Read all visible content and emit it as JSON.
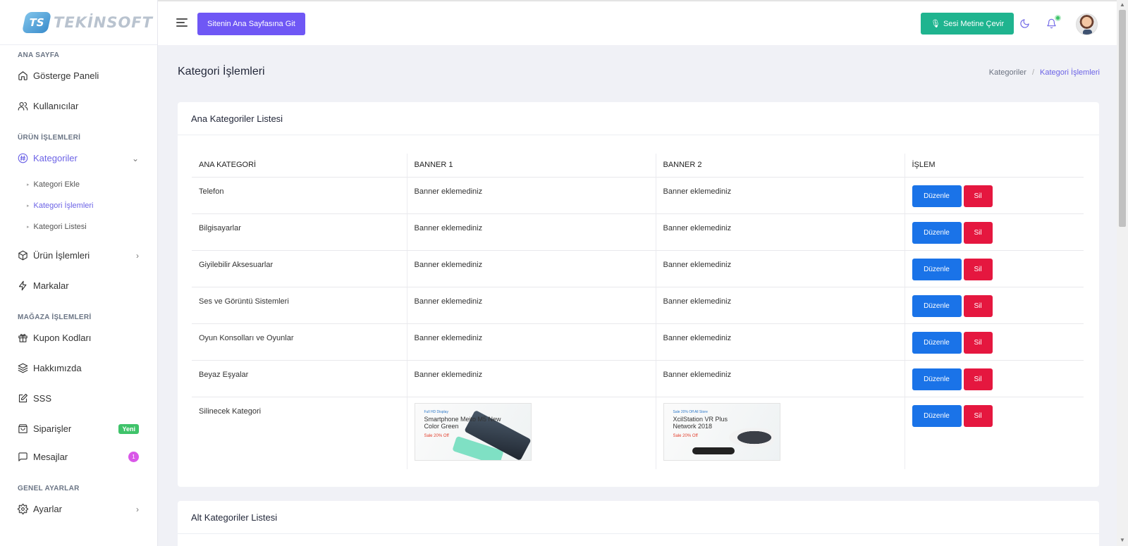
{
  "brand": {
    "logo_mark": "TS",
    "name": "TEKİNSOFT"
  },
  "sidebar": {
    "sections": {
      "home": "ANA SAYFA",
      "products": "ÜRÜN İŞLEMLERİ",
      "store": "MAĞAZA İŞLEMLERİ",
      "general": "GENEL AYARLAR"
    },
    "items": {
      "dashboard": "Gösterge Paneli",
      "users": "Kullanıcılar",
      "categories": "Kategoriler",
      "sub_add": "Kategori Ekle",
      "sub_ops": "Kategori İşlemleri",
      "sub_list": "Kategori Listesi",
      "product_ops": "Ürün İşlemleri",
      "brands": "Markalar",
      "coupons": "Kupon Kodları",
      "about": "Hakkımızda",
      "faq": "SSS",
      "orders": "Siparişler",
      "orders_badge": "Yeni",
      "messages": "Mesajlar",
      "messages_count": "1",
      "settings": "Ayarlar"
    }
  },
  "topbar": {
    "go_site": "Sitenin Ana Sayfasına Git",
    "voice": "Sesi Metine Çevir"
  },
  "page": {
    "title": "Kategori İşlemleri",
    "breadcrumb": [
      "Kategoriler",
      "Kategori İşlemleri"
    ]
  },
  "main_list": {
    "title": "Ana Kategoriler Listesi",
    "headers": [
      "ANA KATEGORİ",
      "BANNER 1",
      "BANNER 2",
      "İŞLEM"
    ],
    "edit_label": "Düzenle",
    "delete_label": "Sil",
    "rows": [
      {
        "name": "Telefon",
        "banner1": "Banner eklemediniz",
        "banner2": "Banner eklemediniz"
      },
      {
        "name": "Bilgisayarlar",
        "banner1": "Banner eklemediniz",
        "banner2": "Banner eklemediniz"
      },
      {
        "name": "Giyilebilir Aksesuarlar",
        "banner1": "Banner eklemediniz",
        "banner2": "Banner eklemediniz"
      },
      {
        "name": "Ses ve Görüntü Sistemleri",
        "banner1": "Banner eklemediniz",
        "banner2": "Banner eklemediniz"
      },
      {
        "name": "Oyun Konsolları ve Oyunlar",
        "banner1": "Banner eklemediniz",
        "banner2": "Banner eklemediniz"
      },
      {
        "name": "Beyaz Eşyalar",
        "banner1": "Banner eklemediniz",
        "banner2": "Banner eklemediniz"
      },
      {
        "name": "Silinecek Kategori"
      }
    ],
    "banner_phone": {
      "tag": "Full HD Display",
      "title": "Smartphone Meito M5 New Color Green",
      "sale": "Sale 20% Off"
    },
    "banner_vr": {
      "tag": "Sale 20% Off All Store",
      "title": "XcilStation VR Plus Network 2018",
      "sale": "Sale 20% Off"
    }
  },
  "sub_list": {
    "title": "Alt Kategoriler Listesi"
  },
  "icons": [
    "home-icon",
    "users-icon",
    "hash-icon",
    "box-icon",
    "bolt-icon",
    "gift-icon",
    "layers-icon",
    "edit-icon",
    "bag-icon",
    "message-icon",
    "gear-icon",
    "moon-icon",
    "bell-icon",
    "mic-icon",
    "menu-icon"
  ]
}
